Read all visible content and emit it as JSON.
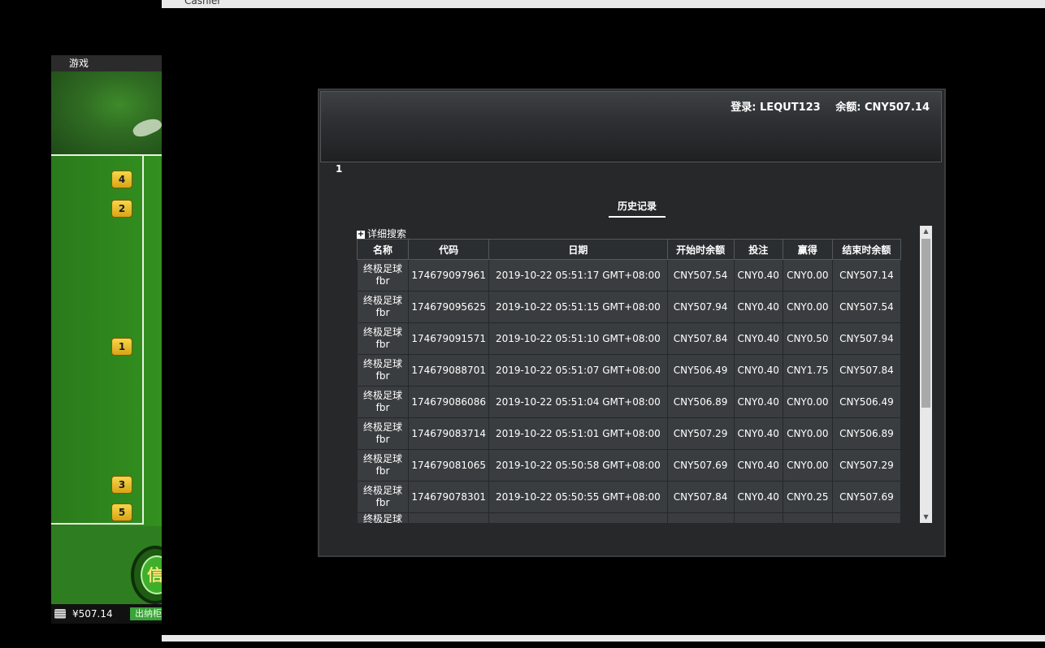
{
  "game_window": {
    "title": "游戏",
    "chips": [
      "4",
      "2",
      "1",
      "3",
      "5"
    ],
    "button_text": "信",
    "balance": "¥507.14",
    "cashier_button": "出纳柜"
  },
  "cashier_window": {
    "title": "Cashier"
  },
  "panel": {
    "login_label": "登录: LEQUT123",
    "balance_label": "余额: CNY507.14",
    "page_number": "1",
    "history_tab": "历史记录",
    "advanced_search": "详细搜索"
  },
  "table": {
    "headers": [
      "名称",
      "代码",
      "日期",
      "开始时余额",
      "投注",
      "赢得",
      "结束时余额"
    ],
    "rows": [
      {
        "name": "终极足球 fbr",
        "code": "174679097961",
        "date": "2019-10-22 05:51:17 GMT+08:00",
        "start": "CNY507.54",
        "bet": "CNY0.40",
        "win": "CNY0.00",
        "end": "CNY507.14"
      },
      {
        "name": "终极足球 fbr",
        "code": "174679095625",
        "date": "2019-10-22 05:51:15 GMT+08:00",
        "start": "CNY507.94",
        "bet": "CNY0.40",
        "win": "CNY0.00",
        "end": "CNY507.54"
      },
      {
        "name": "终极足球 fbr",
        "code": "174679091571",
        "date": "2019-10-22 05:51:10 GMT+08:00",
        "start": "CNY507.84",
        "bet": "CNY0.40",
        "win": "CNY0.50",
        "end": "CNY507.94"
      },
      {
        "name": "终极足球 fbr",
        "code": "174679088701",
        "date": "2019-10-22 05:51:07 GMT+08:00",
        "start": "CNY506.49",
        "bet": "CNY0.40",
        "win": "CNY1.75",
        "end": "CNY507.84"
      },
      {
        "name": "终极足球 fbr",
        "code": "174679086086",
        "date": "2019-10-22 05:51:04 GMT+08:00",
        "start": "CNY506.89",
        "bet": "CNY0.40",
        "win": "CNY0.00",
        "end": "CNY506.49"
      },
      {
        "name": "终极足球 fbr",
        "code": "174679083714",
        "date": "2019-10-22 05:51:01 GMT+08:00",
        "start": "CNY507.29",
        "bet": "CNY0.40",
        "win": "CNY0.00",
        "end": "CNY506.89"
      },
      {
        "name": "终极足球 fbr",
        "code": "174679081065",
        "date": "2019-10-22 05:50:58 GMT+08:00",
        "start": "CNY507.69",
        "bet": "CNY0.40",
        "win": "CNY0.00",
        "end": "CNY507.29"
      },
      {
        "name": "终极足球 fbr",
        "code": "174679078301",
        "date": "2019-10-22 05:50:55 GMT+08:00",
        "start": "CNY507.84",
        "bet": "CNY0.40",
        "win": "CNY0.25",
        "end": "CNY507.69"
      }
    ],
    "partial_row_name": "终极足球"
  },
  "icons": {
    "scroll_up": "triangle-up",
    "scroll_down": "triangle-down",
    "expand": "plus-box",
    "coins": "coin-stack"
  }
}
